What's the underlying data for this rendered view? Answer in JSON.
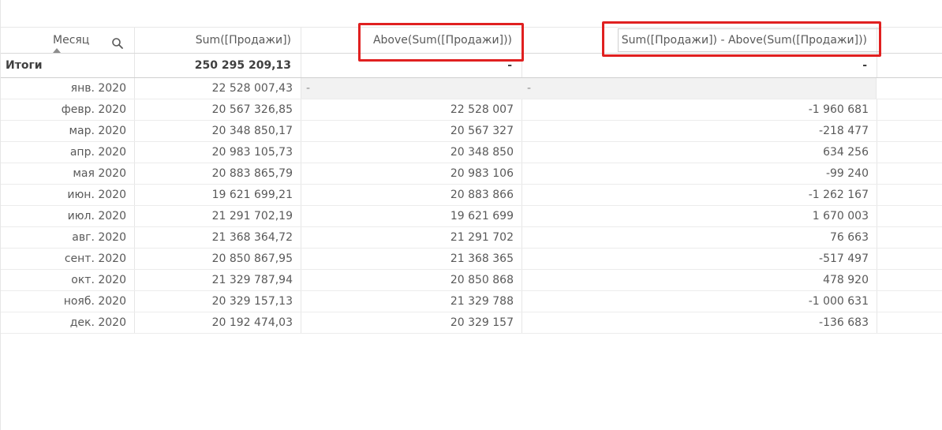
{
  "table": {
    "headers": {
      "month": "Месяц",
      "sum": "Sum([Продажи])",
      "above": "Above(Sum([Продажи]))",
      "diff": "Sum([Продажи]) - Above(Sum([Продажи]))"
    },
    "totals": {
      "label": "Итоги",
      "sum": "250 295 209,13",
      "above": "-",
      "diff": "-"
    },
    "null_value": "-",
    "rows": [
      {
        "month": "янв. 2020",
        "sum": "22 528 007,43",
        "above": "-",
        "diff": "-"
      },
      {
        "month": "февр. 2020",
        "sum": "20 567 326,85",
        "above": "22 528 007",
        "diff": "-1 960 681"
      },
      {
        "month": "мар. 2020",
        "sum": "20 348 850,17",
        "above": "20 567 327",
        "diff": "-218 477"
      },
      {
        "month": "апр. 2020",
        "sum": "20 983 105,73",
        "above": "20 348 850",
        "diff": "634 256"
      },
      {
        "month": "мая 2020",
        "sum": "20 883 865,79",
        "above": "20 983 106",
        "diff": "-99 240"
      },
      {
        "month": "июн. 2020",
        "sum": "19 621 699,21",
        "above": "20 883 866",
        "diff": "-1 262 167"
      },
      {
        "month": "июл. 2020",
        "sum": "21 291 702,19",
        "above": "19 621 699",
        "diff": "1 670 003"
      },
      {
        "month": "авг. 2020",
        "sum": "21 368 364,72",
        "above": "21 291 702",
        "diff": "76 663"
      },
      {
        "month": "сент. 2020",
        "sum": "20 850 867,95",
        "above": "21 368 365",
        "diff": "-517 497"
      },
      {
        "month": "окт. 2020",
        "sum": "21 329 787,94",
        "above": "20 850 868",
        "diff": "478 920"
      },
      {
        "month": "нояб. 2020",
        "sum": "20 329 157,13",
        "above": "21 329 788",
        "diff": "-1 000 631"
      },
      {
        "month": "дек. 2020",
        "sum": "20 192 474,03",
        "above": "20 329 157",
        "diff": "-136 683"
      }
    ]
  },
  "icons": {
    "search": "search-icon",
    "sort": "sort-ascending-icon"
  },
  "colors": {
    "highlight": "#e02020",
    "null_bg": "#f2f2f2"
  }
}
